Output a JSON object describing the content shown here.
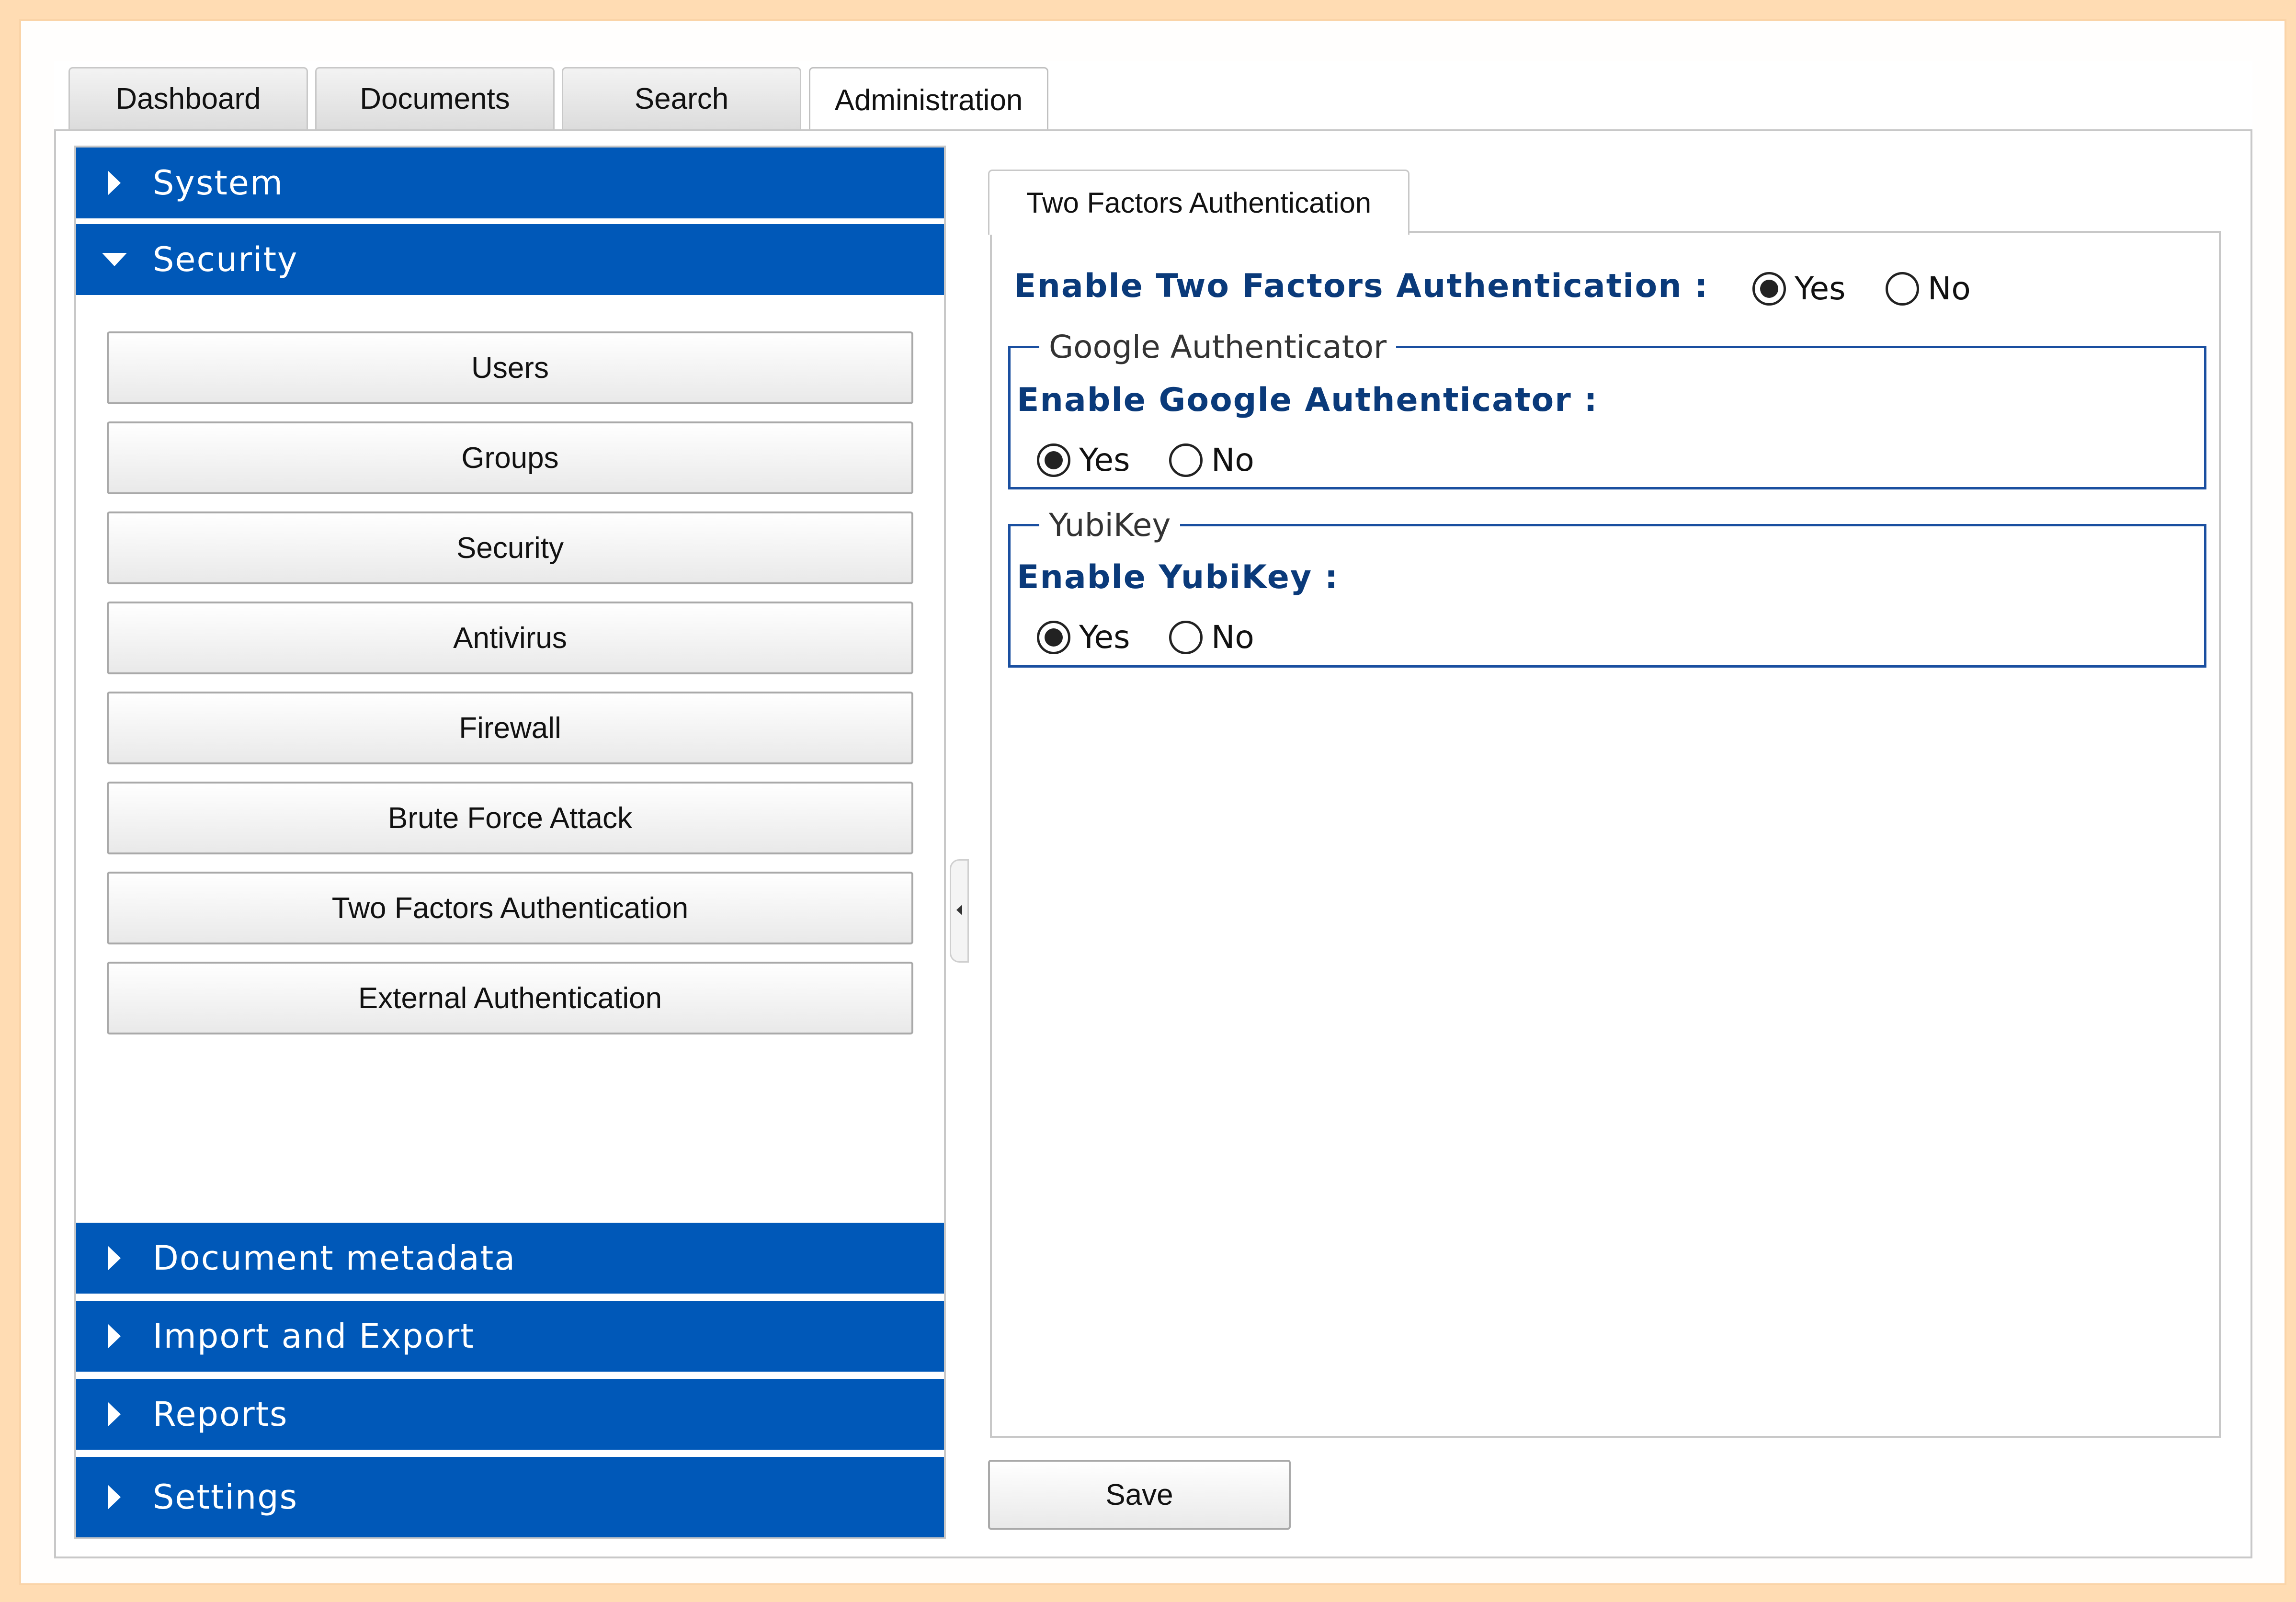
{
  "tabs": [
    {
      "label": "Dashboard"
    },
    {
      "label": "Documents"
    },
    {
      "label": "Search"
    },
    {
      "label": "Administration"
    }
  ],
  "sidebar": {
    "system": "System",
    "security": "Security",
    "security_items": [
      "Users",
      "Groups",
      "Security",
      "Antivirus",
      "Firewall",
      "Brute Force Attack",
      "Two Factors Authentication",
      "External Authentication"
    ],
    "document_metadata": "Document metadata",
    "import_export": "Import and Export",
    "reports": "Reports",
    "settings": "Settings"
  },
  "panel": {
    "tab_label": "Two Factors Authentication",
    "enable_2fa_label": "Enable Two Factors Authentication  :",
    "enable_2fa_value": "Yes",
    "yes": "Yes",
    "no": "No",
    "google": {
      "legend": "Google Authenticator",
      "label": "Enable Google Authenticator :",
      "value": "Yes"
    },
    "yubikey": {
      "legend": "YubiKey",
      "label": "Enable YubiKey :",
      "value": "Yes"
    },
    "save_label": "Save"
  }
}
